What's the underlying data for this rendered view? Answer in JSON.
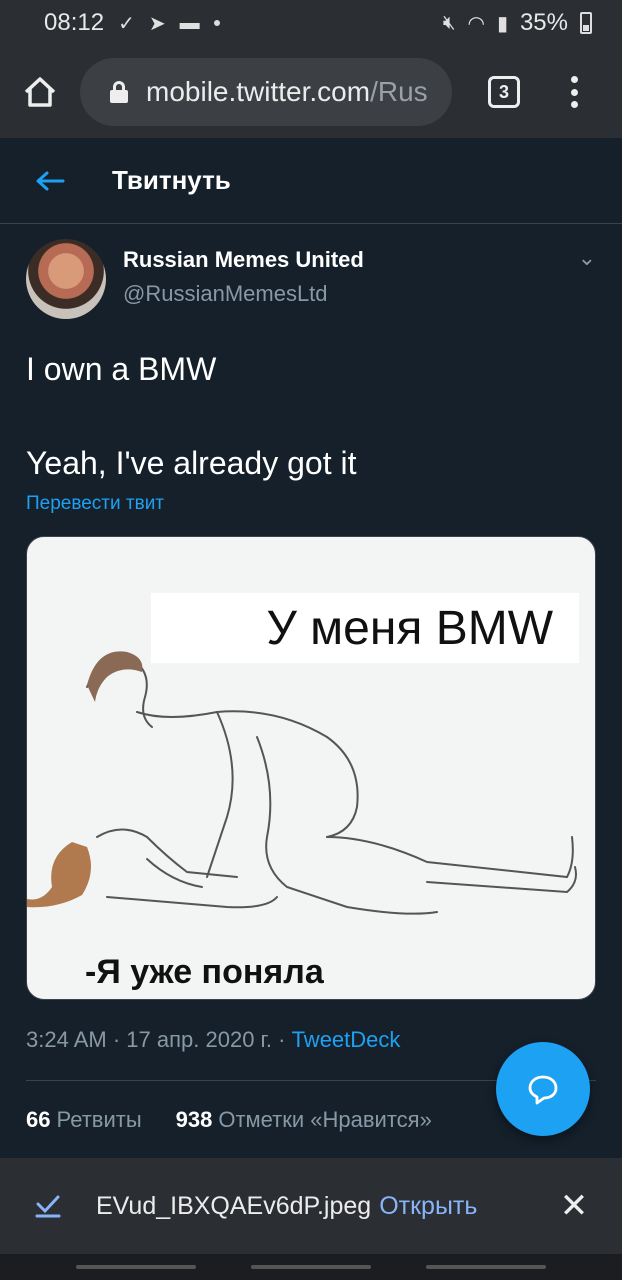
{
  "status_bar": {
    "time": "08:12",
    "battery": "35%"
  },
  "browser": {
    "url_host": "mobile.twitter.com",
    "url_path": "/Rus",
    "tab_count": "3"
  },
  "header": {
    "title": "Твитнуть"
  },
  "tweet": {
    "author_name": "Russian Memes United",
    "author_handle": "@RussianMemesLtd",
    "text_line1": "I own a BMW",
    "text_line2": "Yeah, I've already got it",
    "translate_label": "Перевести твит",
    "image_caption_top": "У меня BMW",
    "image_caption_bottom": "-Я уже поняла",
    "time": "3:24 AM",
    "date": "17 апр. 2020 г.",
    "source": "TweetDeck",
    "retweets_count": "66",
    "retweets_label": "Ретвиты",
    "likes_count": "938",
    "likes_label": "Отметки «Нравится»"
  },
  "download_bar": {
    "file_name": "EVud_IBXQAEv6dP.jpeg",
    "open_label": "Открыть"
  },
  "colors": {
    "accent": "#1da1f2",
    "background": "#15202b",
    "chrome": "#2b2e33"
  }
}
